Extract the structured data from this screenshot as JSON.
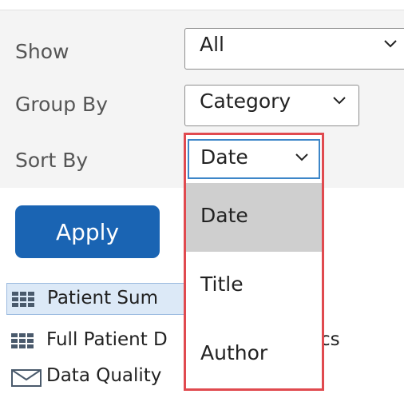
{
  "filters": {
    "show": {
      "label": "Show",
      "value": "All"
    },
    "group_by": {
      "label": "Group By",
      "value": "Category"
    },
    "sort_by": {
      "label": "Sort By",
      "value": "Date"
    }
  },
  "apply_label": "Apply",
  "sort_options": [
    "Date",
    "Title",
    "Author"
  ],
  "highlighted_option": "Date",
  "list": [
    {
      "text": "Patient Sum",
      "icon": "grid-icon",
      "selected": true
    },
    {
      "text": "Full Patient D",
      "icon": "grid-icon",
      "trailing": "cs",
      "selected": false
    },
    {
      "text": "Data Quality",
      "icon": "mail-icon",
      "selected": false
    }
  ],
  "colors": {
    "accent": "#1a64b3",
    "dropdown_outline": "#e04a4f",
    "highlight": "#cfcfcf",
    "panel_bg": "#f4f4f4"
  }
}
